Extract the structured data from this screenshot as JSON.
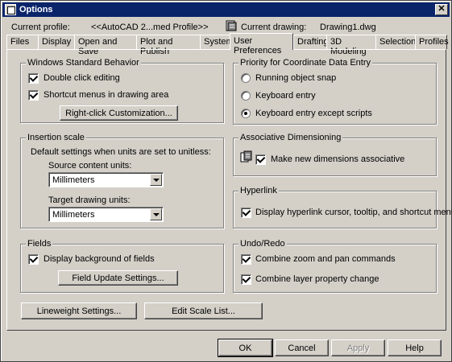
{
  "window": {
    "title": "Options",
    "close_glyph": "✕"
  },
  "header": {
    "profile_label": "Current profile:",
    "profile_value": "<<AutoCAD 2...med Profile>>",
    "drawing_label": "Current drawing:",
    "drawing_value": "Drawing1.dwg",
    "drawing_icon": "drawing-file-icon"
  },
  "tabs": [
    {
      "label": "Files"
    },
    {
      "label": "Display"
    },
    {
      "label": "Open and Save"
    },
    {
      "label": "Plot and Publish"
    },
    {
      "label": "System"
    },
    {
      "label": "User Preferences",
      "active": true
    },
    {
      "label": "Drafting"
    },
    {
      "label": "3D Modeling"
    },
    {
      "label": "Selection"
    },
    {
      "label": "Profiles"
    }
  ],
  "windows_standard": {
    "title": "Windows Standard Behavior",
    "double_click": {
      "label": "Double click editing",
      "checked": true
    },
    "shortcut_menus": {
      "label": "Shortcut menus in drawing area",
      "checked": true
    },
    "rightclick_button": "Right-click Customization..."
  },
  "insertion_scale": {
    "title": "Insertion scale",
    "description": "Default settings when units are set to unitless:",
    "source_label": "Source content units:",
    "source_value": "Millimeters",
    "target_label": "Target drawing units:",
    "target_value": "Millimeters"
  },
  "fields": {
    "title": "Fields",
    "display_background": {
      "label": "Display background of fields",
      "checked": true
    },
    "update_button": "Field Update Settings..."
  },
  "priority": {
    "title": "Priority for Coordinate Data Entry",
    "options": [
      {
        "label": "Running object snap",
        "selected": false
      },
      {
        "label": "Keyboard entry",
        "selected": false
      },
      {
        "label": "Keyboard entry except scripts",
        "selected": true
      }
    ]
  },
  "associative": {
    "title": "Associative Dimensioning",
    "make_new": {
      "label": "Make new dimensions associative",
      "checked": true
    }
  },
  "hyperlink": {
    "title": "Hyperlink",
    "display": {
      "label": "Display hyperlink cursor, tooltip, and shortcut menu",
      "checked": true
    }
  },
  "undo_redo": {
    "title": "Undo/Redo",
    "combine_zoom": {
      "label": "Combine zoom and pan commands",
      "checked": true
    },
    "combine_layer": {
      "label": "Combine layer property change",
      "checked": true
    }
  },
  "bottom_buttons": {
    "lineweight": "Lineweight Settings...",
    "edit_scale": "Edit Scale List..."
  },
  "dialog_buttons": {
    "ok": "OK",
    "cancel": "Cancel",
    "apply": "Apply",
    "help": "Help"
  }
}
